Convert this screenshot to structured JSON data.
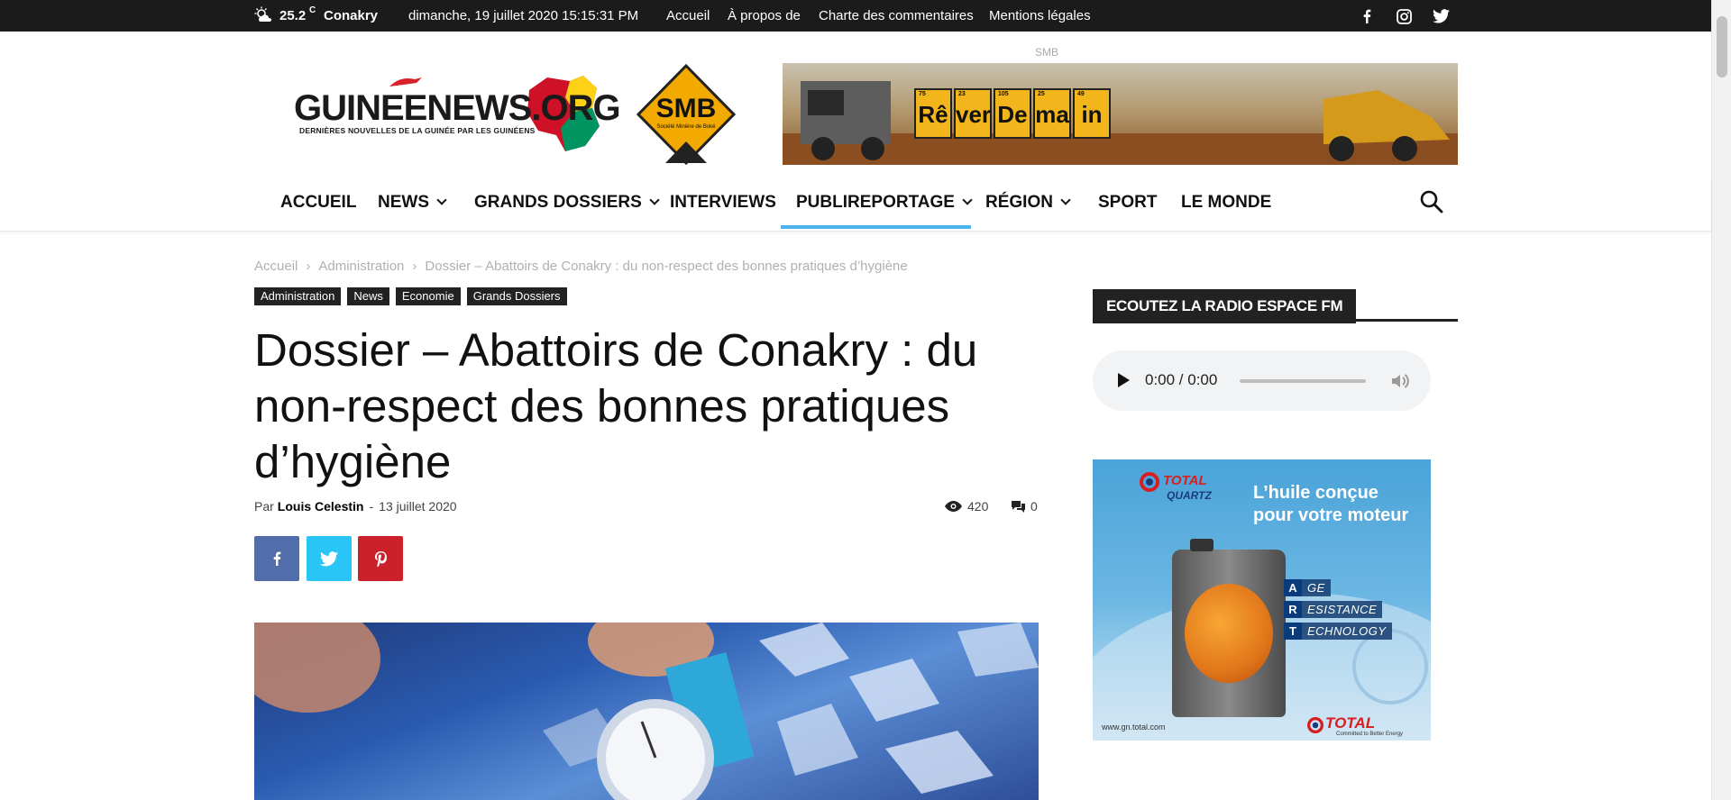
{
  "topbar": {
    "temperature": "25.2",
    "unit": "C",
    "city": "Conakry",
    "datetime": "dimanche, 19 juillet 2020 15:15:31 PM",
    "nav": [
      "Accueil",
      "À propos de",
      "Charte des commentaires",
      "Mentions légales"
    ]
  },
  "header": {
    "logo_text": "GUINEENEWS.ORG",
    "logo_tagline": "DERNIÈRES NOUVELLES DE LA GUINÉE PAR LES GUINÉENS",
    "ad_label": "SMB",
    "banner_smb": "SMB",
    "banner_smb_sub": "Société Minière de Boké",
    "banner_tiles": [
      "Rê",
      "ver",
      "De",
      "ma",
      "in"
    ],
    "banner_tile_numbers": [
      "75",
      "23",
      "105",
      "25",
      "49"
    ]
  },
  "mainnav": {
    "items": [
      {
        "label": "ACCUEIL",
        "dropdown": false
      },
      {
        "label": "NEWS",
        "dropdown": true
      },
      {
        "label": "GRANDS DOSSIERS",
        "dropdown": true
      },
      {
        "label": "INTERVIEWS",
        "dropdown": false
      },
      {
        "label": "PUBLIREPORTAGE",
        "dropdown": true,
        "active": true
      },
      {
        "label": "RÉGION",
        "dropdown": true
      },
      {
        "label": "SPORT",
        "dropdown": false
      },
      {
        "label": "LE MONDE",
        "dropdown": false
      }
    ],
    "active_color": "#4db2ec"
  },
  "breadcrumb": {
    "items": [
      "Accueil",
      "Administration",
      "Dossier – Abattoirs de Conakry : du non-respect des bonnes pratiques d’hygiène"
    ],
    "separator": "›"
  },
  "article": {
    "categories": [
      "Administration",
      "News",
      "Economie",
      "Grands Dossiers"
    ],
    "title": "Dossier – Abattoirs de Conakry : du non-respect des bonnes pratiques d’hygiène",
    "by": "Par",
    "author": "Louis Celestin",
    "separator": "-",
    "date": "13 juillet 2020",
    "views": "420",
    "comments": "0"
  },
  "share": {
    "facebook_color": "#516eab",
    "twitter_color": "#29c5f6",
    "pinterest_color": "#ca212a"
  },
  "sidebar": {
    "widget_title": "ECOUTEZ LA RADIO ESPACE FM",
    "audio_time": "0:00 / 0:00",
    "ad": {
      "brand": "TOTAL",
      "brand_sub": "QUARTZ",
      "tagline": "L’huile conçue pour votre moteur",
      "tech_letters": [
        "A",
        "R",
        "T"
      ],
      "tech_words": [
        "GE",
        "ESISTANCE",
        "ECHNOLOGY"
      ],
      "url": "www.gn.total.com",
      "logo": "TOTAL",
      "logo_sub": "Committed to Better Energy"
    }
  }
}
